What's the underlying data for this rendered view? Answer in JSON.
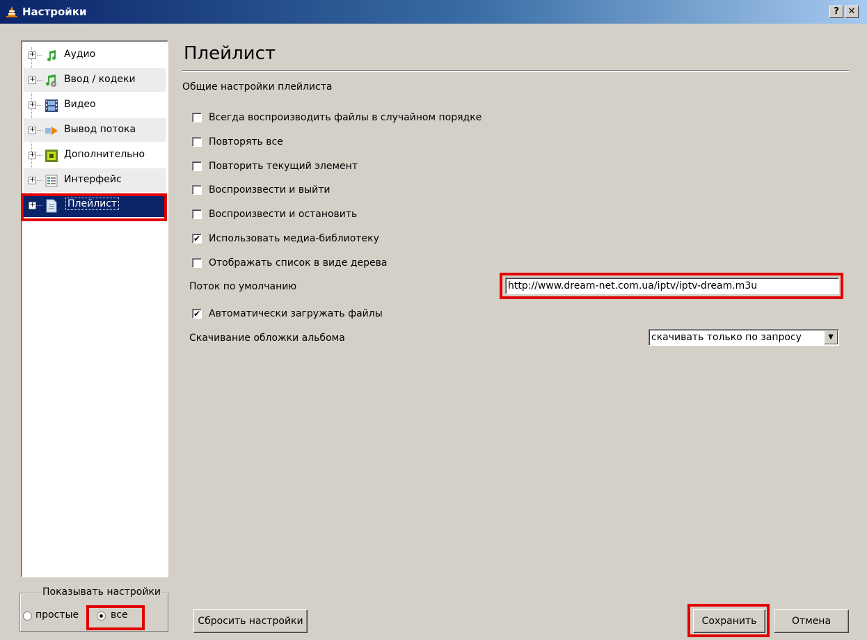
{
  "window": {
    "title": "Настройки",
    "help_label": "?",
    "close_label": "✕"
  },
  "sidebar": {
    "items": [
      {
        "label": "Аудио",
        "icon": "music-note-icon"
      },
      {
        "label": "Ввод / кодеки",
        "icon": "codecs-icon"
      },
      {
        "label": "Видео",
        "icon": "film-icon"
      },
      {
        "label": "Вывод потока",
        "icon": "stream-output-icon"
      },
      {
        "label": "Дополнительно",
        "icon": "chip-icon"
      },
      {
        "label": "Интерфейс",
        "icon": "interface-icon"
      },
      {
        "label": "Плейлист",
        "icon": "playlist-document-icon",
        "selected": true
      }
    ],
    "expander_label": "+"
  },
  "show_settings": {
    "legend": "Показывать настройки",
    "simple_label": "простые",
    "all_label": "все",
    "selected": "all"
  },
  "main": {
    "title": "Плейлист",
    "section": "Общие настройки плейлиста",
    "options": [
      {
        "label": "Всегда воспроизводить файлы в случайном порядке",
        "checked": false
      },
      {
        "label": "Повторять все",
        "checked": false
      },
      {
        "label": "Повторить текущий элемент",
        "checked": false
      },
      {
        "label": "Воспроизвести и выйти",
        "checked": false
      },
      {
        "label": "Воспроизвести и остановить",
        "checked": false
      },
      {
        "label": "Использовать медиа-библиотеку",
        "checked": true
      },
      {
        "label": "Отображать список в виде дерева",
        "checked": false
      }
    ],
    "default_stream_label": "Поток по умолчанию",
    "default_stream_value": "http://www.dream-net.com.ua/iptv/iptv-dream.m3u",
    "autoload_label": "Автоматически загружать файлы",
    "autoload_checked": true,
    "album_art_label": "Скачивание обложки альбома",
    "album_art_value": "скачивать только по запросу",
    "check_mark": "✔",
    "dropdown_arrow": "▼"
  },
  "buttons": {
    "reset": "Сбросить настройки",
    "save": "Сохранить",
    "cancel": "Отмена"
  },
  "colors": {
    "selected_bg": "#0a246a",
    "highlight": "#e00000",
    "window_bg": "#d4d0c8"
  }
}
